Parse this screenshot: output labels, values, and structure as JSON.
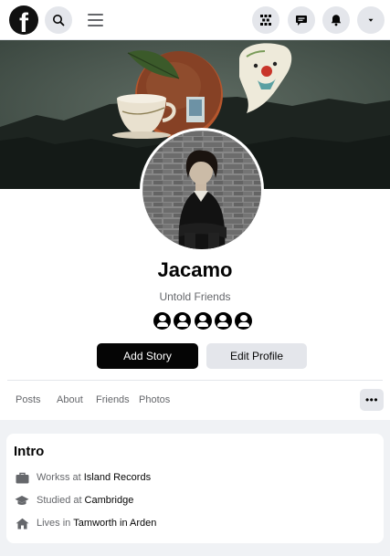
{
  "topbar": {
    "logo_letter": "f",
    "icons": [
      "search-icon",
      "menu-icon",
      "grid-icon",
      "messenger-icon",
      "bell-icon",
      "caret-down-icon"
    ]
  },
  "profile": {
    "name": "Jacamo",
    "subtitle": "Untold Friends",
    "friend_avatars_count": 5,
    "add_story_label": "Add Story",
    "edit_profile_label": "Edit Profile"
  },
  "tabs": [
    {
      "label": "Posts"
    },
    {
      "label": "About"
    },
    {
      "label": "Friends"
    },
    {
      "label": "Photos"
    }
  ],
  "more_label": "•••",
  "intro": {
    "title": "Intro",
    "items": [
      {
        "icon": "briefcase-icon",
        "prefix": "Workss at",
        "value": "Island Records"
      },
      {
        "icon": "graduation-cap-icon",
        "prefix": "Studied at",
        "value": "Cambridge"
      },
      {
        "icon": "home-icon",
        "prefix": "Lives in",
        "value": "Tamworth in Arden"
      }
    ]
  },
  "colors": {
    "accent_dark": "#050505",
    "secondary_button": "#e4e6eb",
    "muted_text": "#65676b",
    "page_bg": "#f0f2f5"
  }
}
